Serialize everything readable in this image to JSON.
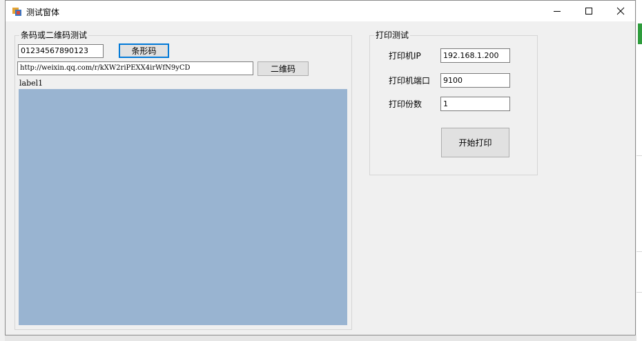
{
  "window": {
    "title": "测试窗体"
  },
  "barcode_group": {
    "title": "条码或二维码测试",
    "barcode_input": "01234567890123",
    "barcode_button": "条形码",
    "qrcode_input": "http://weixin.qq.com/r/kXW2riPEXX4irWfN9yCD",
    "qrcode_button": "二维码",
    "label": "label1",
    "preview_color": "#99b4d1"
  },
  "print_group": {
    "title": "打印测试",
    "ip_label": "打印机IP",
    "ip_value": "192.168.1.200",
    "port_label": "打印机端口",
    "port_value": "9100",
    "copies_label": "打印份数",
    "copies_value": "1",
    "start_button": "开始打印"
  },
  "colors": {
    "focus_accent": "#0078d7",
    "button_face": "#e1e1e1",
    "window_bg": "#f0f0f0"
  }
}
